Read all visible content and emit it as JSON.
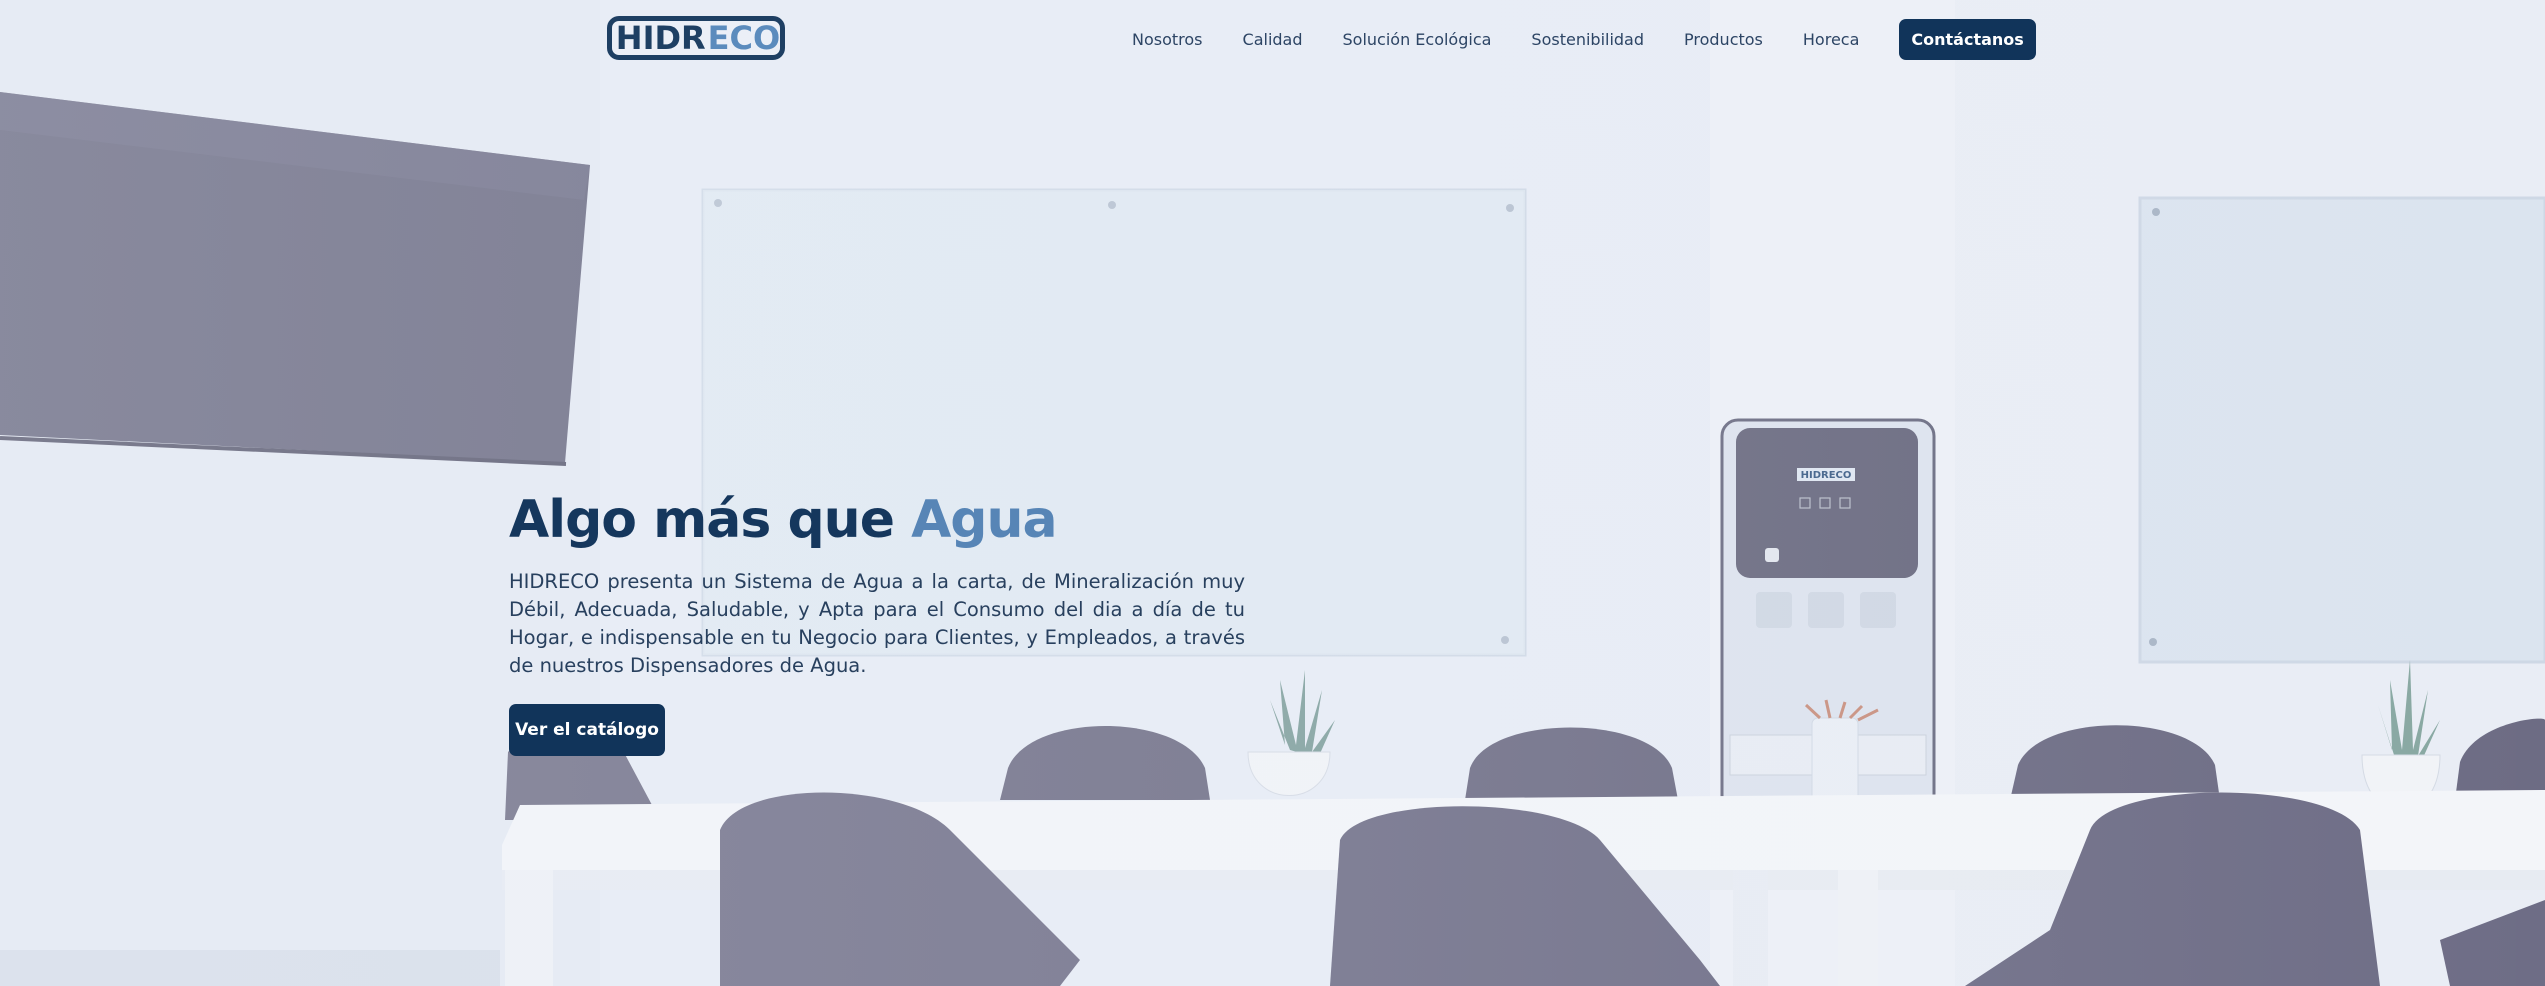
{
  "brand": {
    "logo_main": "HIDR",
    "logo_accent": "ECO",
    "colors": {
      "navy": "#11345a",
      "accent": "#5785b6",
      "text": "#28405e"
    }
  },
  "nav": {
    "items": [
      "Nosotros",
      "Calidad",
      "Solución Ecológica",
      "Sostenibilidad",
      "Productos",
      "Horeca"
    ],
    "cta": "Contáctanos"
  },
  "hero": {
    "title_main": "Algo más que ",
    "title_accent": "Agua",
    "text": "HIDRECO presenta un Sistema de Agua a la carta, de Mineralización muy Débil, Adecuada, Saludable, y Apta para el Consumo del dia a día de tu Hogar, e indispensable en tu Negocio para Clientes, y Empleados, a través de nuestros Dispensadores de Agua.",
    "button": "Ver el catálogo"
  },
  "background": {
    "description_icons": [
      "tv-screen",
      "glass-whiteboard",
      "water-dispenser",
      "plant",
      "chair",
      "table"
    ],
    "dispenser_logo": "HIDRECO"
  }
}
